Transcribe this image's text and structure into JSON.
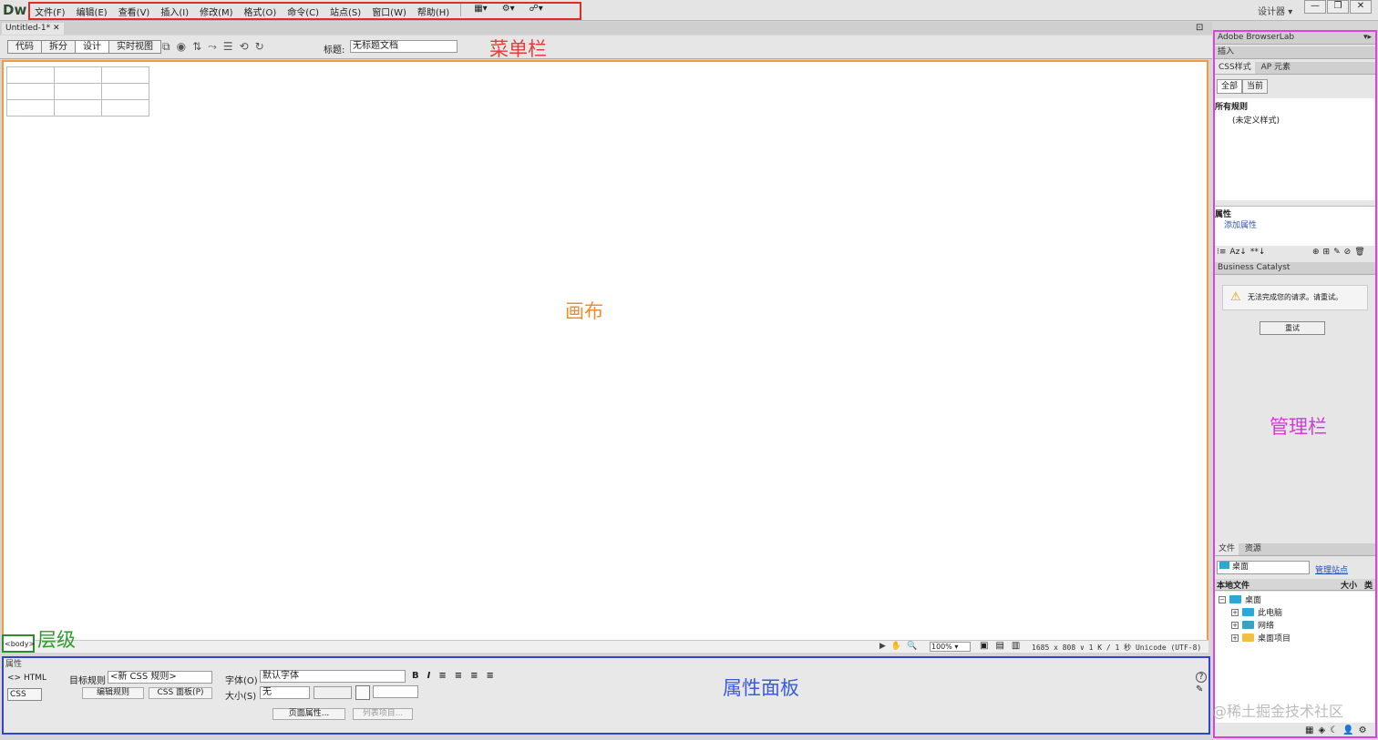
{
  "app": {
    "logo": "Dw",
    "workspace": "设计器",
    "workspace_arrow": "▾"
  },
  "menu": {
    "items": [
      "文件(F)",
      "编辑(E)",
      "查看(V)",
      "插入(I)",
      "修改(M)",
      "格式(O)",
      "命令(C)",
      "站点(S)",
      "窗口(W)",
      "帮助(H)"
    ],
    "tools": [
      "▦▾",
      "⚙▾",
      "☍▾"
    ]
  },
  "window_controls": {
    "minimize": "—",
    "restore": "❐",
    "close": "✕"
  },
  "document": {
    "tab_label": "Untitled-1*",
    "tab_close": "✕",
    "restore": "⊡",
    "views": [
      "代码",
      "拆分",
      "设计",
      "实时视图"
    ],
    "active_view": 2,
    "toolbar_icons": [
      "⧉",
      "◉",
      "⇅",
      "⤳",
      "☰",
      "⟲",
      "↻"
    ],
    "title_label": "标题:",
    "title_value": "无标题文档"
  },
  "status": {
    "tag": "<body>",
    "tools": [
      "▶",
      "✋",
      "🔍"
    ],
    "zoom": "100%",
    "zoom_arrow": "▾",
    "view_icons": [
      "▣",
      "▤",
      "▥"
    ],
    "info": "1685 x 808 ∨ 1 K / 1 秒 Unicode (UTF-8)"
  },
  "properties": {
    "title": "属性",
    "html_btn": "<> HTML",
    "css_btn": "CSS",
    "target_rule_label": "目标规则",
    "target_rule_value": "<新 CSS 规则>",
    "edit_rule": "编辑规则",
    "css_panel": "CSS 面板(P)",
    "font_label": "字体(O)",
    "font_value": "默认字体",
    "size_label": "大小(S)",
    "size_value": "无",
    "format_buttons": [
      "B",
      "I",
      "≡",
      "≡",
      "≡",
      "≡"
    ],
    "page_props": "页面属性...",
    "list_item": "列表项目...",
    "help": "?",
    "edit": "✎"
  },
  "right_panel": {
    "browserlab": "Adobe BrowserLab",
    "insert": "插入",
    "css_tabs": [
      "CSS样式",
      "AP 元素"
    ],
    "css_subtabs": [
      "全部",
      "当前"
    ],
    "all_rules": "所有规则",
    "undefined_style": "(未定义样式)",
    "properties": "属性",
    "add_property": "添加属性",
    "css_tool_icons": [
      "⁝≡",
      "Az↓",
      "**↓"
    ],
    "css_tool_icons_right": [
      "⊕",
      "⊞",
      "✎",
      "⊘",
      "🗑"
    ],
    "bc_title": "Business Catalyst",
    "bc_message": "无法完成您的请求。请重试。",
    "retry": "重试",
    "files_tabs": [
      "文件",
      "资源"
    ],
    "location": "桌面",
    "manage_site": "管理站点",
    "files_columns": [
      "本地文件",
      "大小",
      "类"
    ],
    "tree": [
      {
        "toggle": "−",
        "label": "桌面"
      },
      {
        "toggle": "+",
        "label": "此电脑"
      },
      {
        "toggle": "+",
        "label": "网络"
      },
      {
        "toggle": "+",
        "label": "桌面项目"
      }
    ],
    "bottom_icons": [
      "▦",
      "◈",
      "☾",
      "👤",
      "⚙"
    ],
    "collapse": "▾▸"
  },
  "annotations": {
    "menu": "菜单栏",
    "canvas": "画布",
    "layer": "层级",
    "props": "属性面板",
    "manage": "管理栏"
  },
  "watermark": "@稀土掘金技术社区",
  "colors": {
    "menu_box": "#e12b2b",
    "canvas_border": "#f39a3b",
    "layer_border": "#2e8b2e",
    "props_border": "#3344cc",
    "right_border": "#e040e0"
  }
}
